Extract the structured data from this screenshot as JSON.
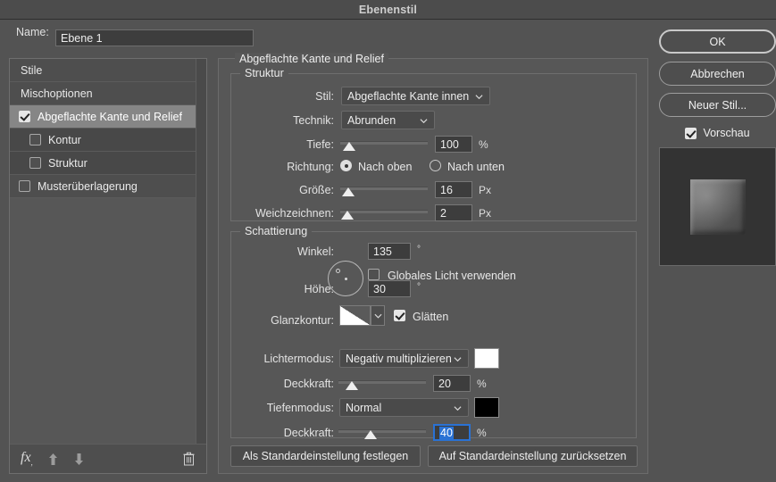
{
  "window": {
    "title": "Ebenenstil"
  },
  "name_row": {
    "label": "Name:",
    "value": "Ebene 1",
    "placeholder": "Ebene 1"
  },
  "sidebar": {
    "items": [
      {
        "label": "Stile",
        "checkbox": null,
        "state": "plain",
        "indent": false
      },
      {
        "label": "Mischoptionen",
        "checkbox": null,
        "state": "plain",
        "indent": false
      },
      {
        "label": "Abgeflachte Kante und Relief",
        "checkbox": "checked",
        "state": "selected",
        "indent": false
      },
      {
        "label": "Kontur",
        "checkbox": "unchecked",
        "state": "sub",
        "indent": true
      },
      {
        "label": "Struktur",
        "checkbox": "unchecked",
        "state": "sub",
        "indent": true
      },
      {
        "label": "Musterüberlagerung",
        "checkbox": "unchecked",
        "state": "normal",
        "indent": false
      }
    ],
    "footer": {
      "fx_label": "fx",
      "icons": [
        "fx-icon",
        "arrow-up-icon",
        "arrow-down-icon",
        "trash-icon"
      ]
    }
  },
  "main": {
    "section_title": "Abgeflachte Kante und Relief",
    "struktur": {
      "legend": "Struktur",
      "stil": {
        "label": "Stil:",
        "value": "Abgeflachte Kante innen"
      },
      "technik": {
        "label": "Technik:",
        "value": "Abrunden"
      },
      "tiefe": {
        "label": "Tiefe:",
        "value": "100",
        "unit": "%",
        "slider_pct": 10
      },
      "richtung": {
        "label": "Richtung:",
        "option_up": "Nach oben",
        "option_down": "Nach unten",
        "selected": "Nach oben"
      },
      "groesse": {
        "label": "Größe:",
        "value": "16",
        "unit": "Px",
        "slider_pct": 9
      },
      "weichzeichnen": {
        "label": "Weichzeichnen:",
        "value": "2",
        "unit": "Px",
        "slider_pct": 7
      }
    },
    "schattierung": {
      "legend": "Schattierung",
      "winkel": {
        "label": "Winkel:",
        "value": "135",
        "unit": "°"
      },
      "globales_licht": {
        "label": "Globales Licht verwenden",
        "checked": false
      },
      "hoehe": {
        "label": "Höhe:",
        "value": "30",
        "unit": "°"
      },
      "glanzkontur": {
        "label": "Glanzkontur:"
      },
      "glaetten": {
        "label": "Glätten",
        "checked": true
      },
      "lichtermodus": {
        "label": "Lichtermodus:",
        "value": "Negativ multiplizieren",
        "color": "#ffffff"
      },
      "deckkraft_licht": {
        "label": "Deckkraft:",
        "value": "20",
        "unit": "%",
        "slider_pct": 16
      },
      "tiefenmodus": {
        "label": "Tiefenmodus:",
        "value": "Normal",
        "color": "#000000"
      },
      "deckkraft_tiefe": {
        "label": "Deckkraft:",
        "value": "40",
        "unit": "%",
        "slider_pct": 37,
        "focused": true
      }
    },
    "buttons": {
      "set_default": "Als Standardeinstellung festlegen",
      "reset_default": "Auf Standardeinstellung zurücksetzen"
    }
  },
  "right": {
    "ok": "OK",
    "cancel": "Abbrechen",
    "new_style": "Neuer Stil...",
    "preview": {
      "label": "Vorschau",
      "checked": true
    }
  },
  "colors": {
    "dialog_bg": "#535353",
    "titlebar_bg": "#4c4c4c",
    "panel_bg": "#575757",
    "selection_blue": "#2a72d4"
  }
}
